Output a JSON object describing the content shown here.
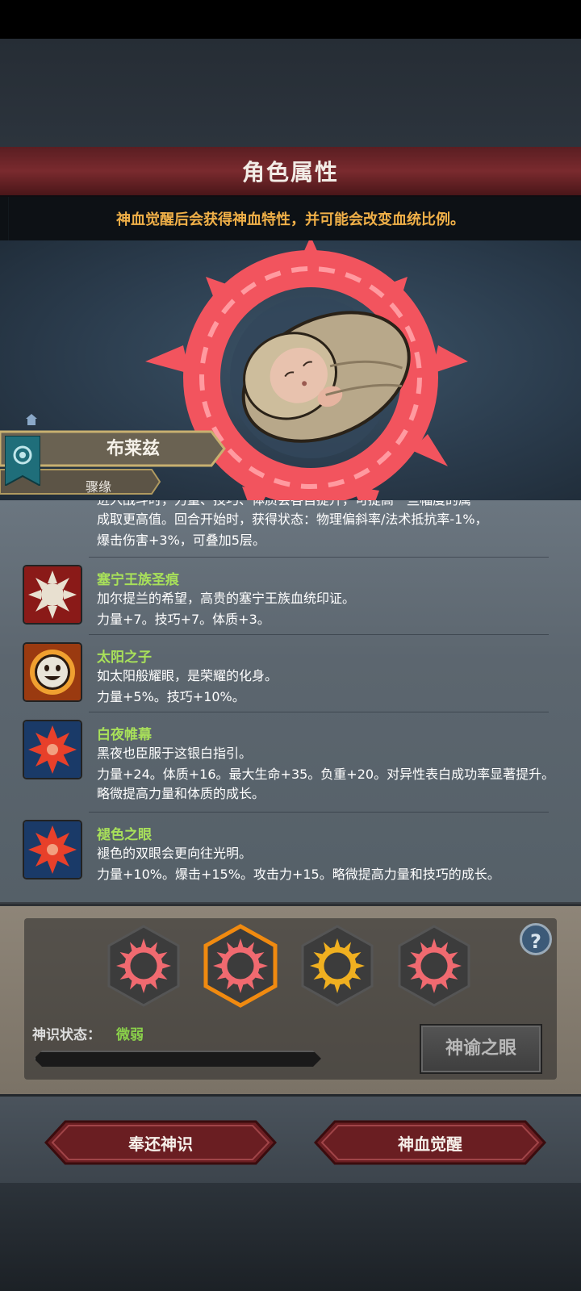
{
  "header": {
    "title": "角色属性"
  },
  "notice": {
    "text": "神血觉醒后会获得神血特性，并可能会改变血统比例。"
  },
  "character": {
    "name": "布莱兹",
    "relation": "骤缘"
  },
  "traits": {
    "partial_top": {
      "line1": "进入战斗时，力量、技巧、体质会各自提升，可提高一些幅度的属",
      "line2": "成取更高值。回合开始时，获得状态：物理偏斜率/法术抵抗率-1%，",
      "line3": "爆击伤害+3%，可叠加5层。"
    },
    "items": [
      {
        "name": "塞宁王族圣痕",
        "desc": "加尔提兰的希望，高贵的塞宁王族血统印证。",
        "effect": "力量+7。技巧+7。体质+3。",
        "icon": "holy-sun-icon"
      },
      {
        "name": "太阳之子",
        "desc": "如太阳般耀眼，是荣耀的化身。",
        "effect": "力量+5%。技巧+10%。",
        "icon": "smiling-sun-icon"
      },
      {
        "name": "白夜帷幕",
        "desc": "黑夜也臣服于这银白指引。",
        "effect": "力量+24。体质+16。最大生命+35。负重+20。对异性表白成功率显著提升。略微提高力量和体质的成长。",
        "icon": "red-sun-icon"
      },
      {
        "name": "褪色之眼",
        "desc": "褪色的双眼会更向往光明。",
        "effect": "力量+10%。爆击+15%。攻击力+15。略微提高力量和技巧的成长。",
        "icon": "red-sun-icon"
      }
    ]
  },
  "divine": {
    "status_label": "神识状态：",
    "status_value": "微弱",
    "progress": 0.0,
    "oracle_button": "神谕之眼",
    "help": "?",
    "sigils": [
      {
        "color": "#f06a70",
        "selected": false
      },
      {
        "color": "#f06a70",
        "selected": true
      },
      {
        "color": "#f0b020",
        "selected": false
      },
      {
        "color": "#f06a70",
        "selected": false
      }
    ]
  },
  "buttons": {
    "return": "奉还神识",
    "awaken": "神血觉醒"
  },
  "colors": {
    "accent_red": "#7a2a2e",
    "trait_name": "#a8e05a",
    "notice": "#f0b048"
  }
}
